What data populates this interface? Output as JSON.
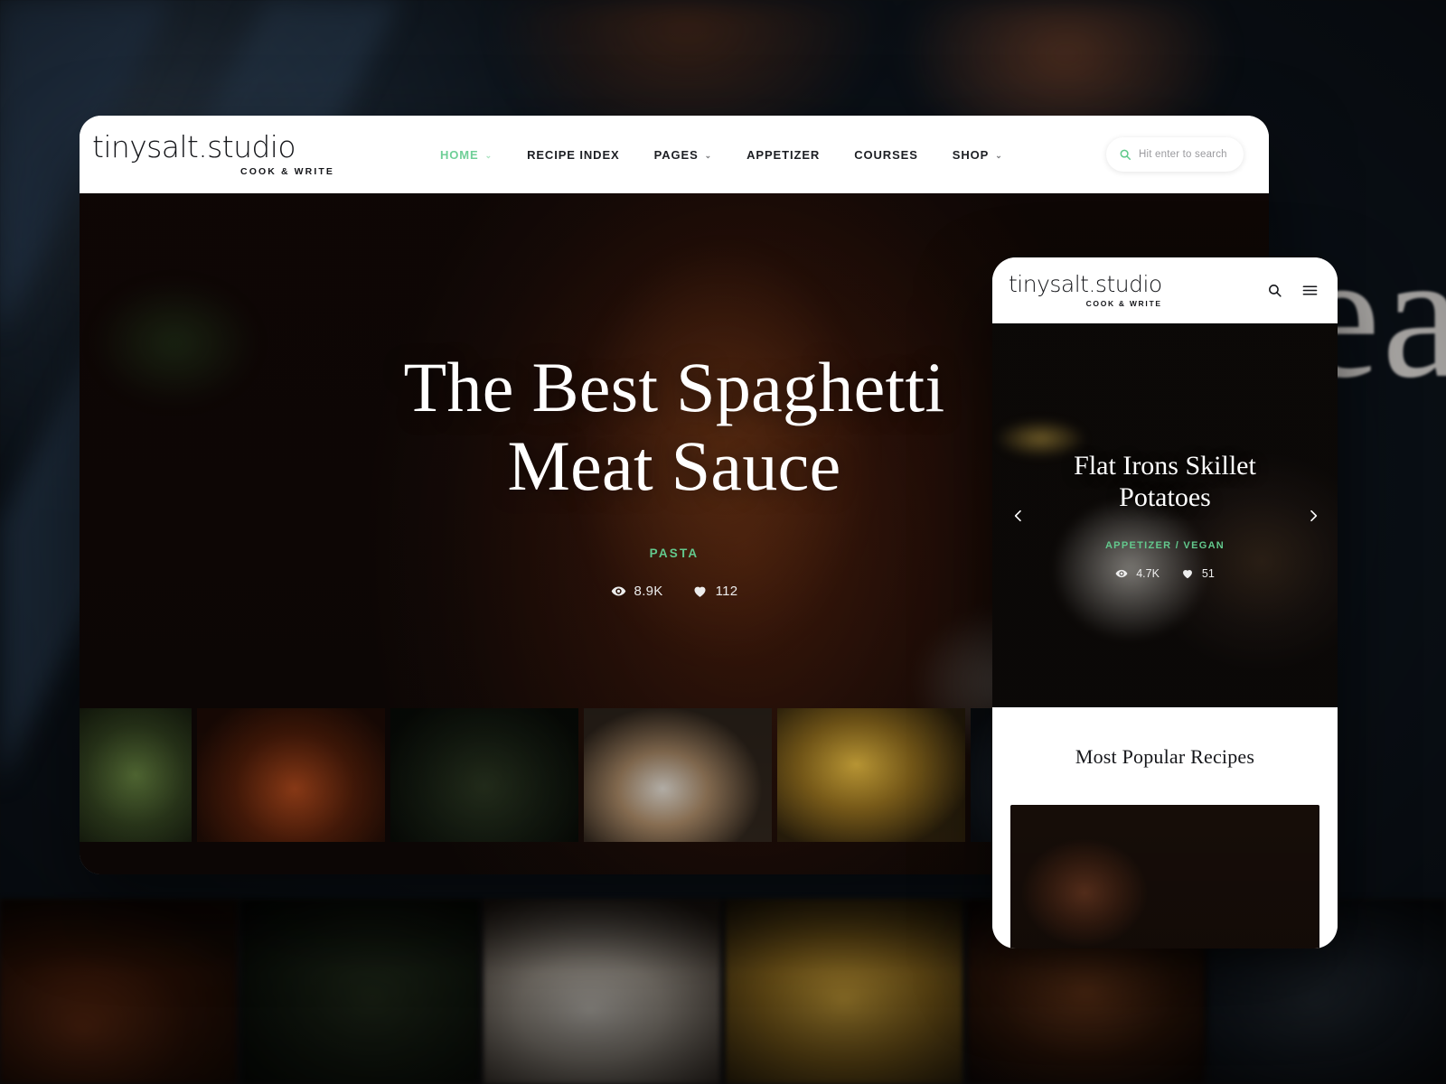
{
  "background": {
    "ghost_text": "ea"
  },
  "desktop": {
    "logo": {
      "main": "tinysalt.studio",
      "sub": "COOK & WRITE"
    },
    "nav": [
      {
        "label": "HOME",
        "caret": "⌄",
        "active": true
      },
      {
        "label": "RECIPE INDEX",
        "caret": "",
        "active": false
      },
      {
        "label": "PAGES",
        "caret": "⌄",
        "active": false
      },
      {
        "label": "APPETIZER",
        "caret": "",
        "active": false
      },
      {
        "label": "COURSES",
        "caret": "",
        "active": false
      },
      {
        "label": "SHOP",
        "caret": "⌄",
        "active": false
      }
    ],
    "search": {
      "placeholder": "Hit enter to search",
      "icon": "search-icon"
    },
    "hero": {
      "title": "The Best Spaghetti Meat Sauce",
      "category": "PASTA",
      "views": "8.9K",
      "likes": "112"
    },
    "thumbnails": [
      {
        "name": "thumb-greens"
      },
      {
        "name": "thumb-spaghetti-meat-sauce"
      },
      {
        "name": "thumb-dark-greens"
      },
      {
        "name": "thumb-skillet-potatoes"
      },
      {
        "name": "thumb-soup-bowls"
      },
      {
        "name": "thumb-blue-plate"
      }
    ]
  },
  "mobile": {
    "logo": {
      "main": "tinysalt.studio",
      "sub": "COOK & WRITE"
    },
    "actions": [
      {
        "name": "search-icon"
      },
      {
        "name": "hamburger-menu-icon"
      }
    ],
    "hero": {
      "title": "Flat Irons Skillet Potatoes",
      "category": "APPETIZER / VEGAN",
      "views": "4.7K",
      "likes": "51",
      "prev_label": "‹",
      "next_label": "›"
    },
    "section": {
      "title": "Most Popular Recipes",
      "card_name": "recipe-card-chocolate-bowl"
    }
  },
  "colors": {
    "accent_green": "#6fcf97",
    "text_dark": "#15161a",
    "card_white": "#ffffff"
  }
}
